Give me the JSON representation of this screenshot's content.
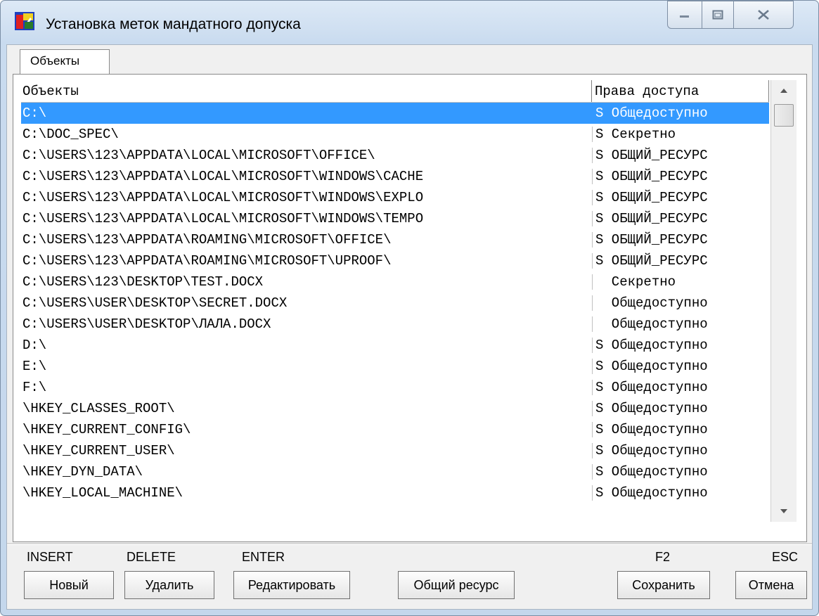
{
  "window": {
    "title": "Установка меток мандатного допуска"
  },
  "tab": {
    "label": "Объекты"
  },
  "list": {
    "col_object": "Объекты",
    "col_rights": "Права доступа",
    "rows": [
      {
        "object": "C:\\",
        "rights": "S Общедоступно",
        "selected": true
      },
      {
        "object": "C:\\DOC_SPEC\\",
        "rights": "S Секретно"
      },
      {
        "object": "C:\\USERS\\123\\APPDATA\\LOCAL\\MICROSOFT\\OFFICE\\",
        "rights": "S ОБЩИЙ_РЕСУРС"
      },
      {
        "object": "C:\\USERS\\123\\APPDATA\\LOCAL\\MICROSOFT\\WINDOWS\\CACHE",
        "rights": "S ОБЩИЙ_РЕСУРС"
      },
      {
        "object": "C:\\USERS\\123\\APPDATA\\LOCAL\\MICROSOFT\\WINDOWS\\EXPLO",
        "rights": "S ОБЩИЙ_РЕСУРС"
      },
      {
        "object": "C:\\USERS\\123\\APPDATA\\LOCAL\\MICROSOFT\\WINDOWS\\TEMPO",
        "rights": "S ОБЩИЙ_РЕСУРС"
      },
      {
        "object": "C:\\USERS\\123\\APPDATA\\ROAMING\\MICROSOFT\\OFFICE\\",
        "rights": "S ОБЩИЙ_РЕСУРС"
      },
      {
        "object": "C:\\USERS\\123\\APPDATA\\ROAMING\\MICROSOFT\\UPROOF\\",
        "rights": "S ОБЩИЙ_РЕСУРС"
      },
      {
        "object": "C:\\USERS\\123\\DESKTOP\\TEST.DOCX",
        "rights": "  Секретно"
      },
      {
        "object": "C:\\USERS\\USER\\DESKTOP\\SECRET.DOCX",
        "rights": "  Общедоступно"
      },
      {
        "object": "C:\\USERS\\USER\\DESKTOP\\ЛАЛА.DOCX",
        "rights": "  Общедоступно"
      },
      {
        "object": "D:\\",
        "rights": "S Общедоступно"
      },
      {
        "object": "E:\\",
        "rights": "S Общедоступно"
      },
      {
        "object": "F:\\",
        "rights": "S Общедоступно"
      },
      {
        "object": "\\HKEY_CLASSES_ROOT\\",
        "rights": "S Общедоступно"
      },
      {
        "object": "\\HKEY_CURRENT_CONFIG\\",
        "rights": "S Общедоступно"
      },
      {
        "object": "\\HKEY_CURRENT_USER\\",
        "rights": "S Общедоступно"
      },
      {
        "object": "\\HKEY_DYN_DATA\\",
        "rights": "S Общедоступно"
      },
      {
        "object": "\\HKEY_LOCAL_MACHINE\\",
        "rights": "S Общедоступно"
      }
    ]
  },
  "buttons": {
    "new": {
      "hotkey": "INSERT",
      "label": "Новый"
    },
    "delete": {
      "hotkey": "DELETE",
      "label": "Удалить"
    },
    "edit": {
      "hotkey": "ENTER",
      "label": "Редактировать"
    },
    "shared": {
      "label": "Общий ресурс"
    },
    "save": {
      "hotkey": "F2",
      "label": "Сохранить"
    },
    "cancel": {
      "hotkey": "ESC",
      "label": "Отмена"
    }
  },
  "icons": {
    "app": "app-icon",
    "minimize": "minimize-icon",
    "maximize": "maximize-icon",
    "close": "close-icon",
    "scroll_up": "scroll-up-arrow-icon",
    "scroll_down": "scroll-down-arrow-icon"
  },
  "colors": {
    "selection": "#3399ff",
    "window_frame": "#c9dbef"
  }
}
